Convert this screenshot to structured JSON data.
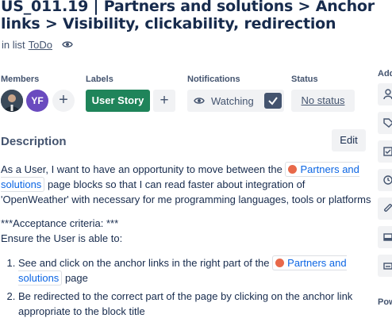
{
  "card": {
    "title": "US_011.19 | Partners and solutions > Anchor links > Visibility, clickability, redirection",
    "in_list_prefix": "in list",
    "list_name": "ToDo"
  },
  "fields": {
    "members_label": "Members",
    "member2_initials": "YF",
    "labels_label": "Labels",
    "label_chip": "User Story",
    "notifications_label": "Notifications",
    "watching": "Watching",
    "status_label": "Status",
    "status_value": "No status"
  },
  "description": {
    "heading": "Description",
    "edit": "Edit",
    "p1_a": "As a User, I want to have an opportunity to move between the",
    "p1_link": "Partners and solutions",
    "p1_b": "page blocks so that I can read faster about integration of 'OpenWeather' with necessary for me programming languages, tools or platforms",
    "criteria": "***Acceptance criteria: ***",
    "ensure": "Ensure the User is able to:",
    "item1_a": "See and click on the anchor links in the right part of the",
    "item1_link": "Partners and solutions",
    "item1_b": "page",
    "item2": "Be redirected to the correct part of the page by clicking on the anchor link appropriate to the block title"
  },
  "sidebar": {
    "add_label": "Add",
    "power_label": "Pow"
  }
}
